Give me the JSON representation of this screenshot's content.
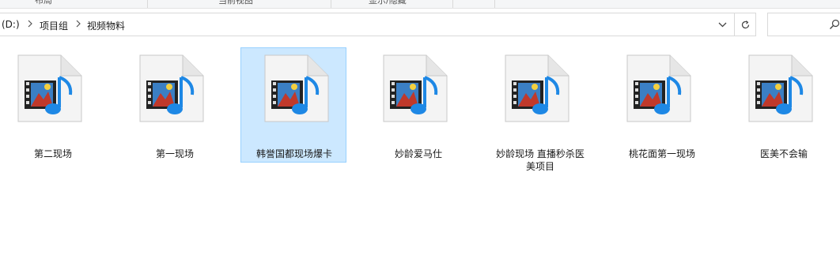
{
  "ribbon": {
    "labels": [
      "布局",
      "当前视图",
      "显示/隐藏"
    ]
  },
  "address": {
    "crumbs": [
      "(D:)",
      "项目组",
      "视频物料"
    ],
    "drive_prefix": "≤"
  },
  "search": {
    "placeholder": ""
  },
  "files": [
    {
      "label": "第二现场",
      "selected": false
    },
    {
      "label": "第一现场",
      "selected": false
    },
    {
      "label": "韩誉国都现场爆卡",
      "selected": true
    },
    {
      "label": "妙龄爱马仕",
      "selected": false
    },
    {
      "label": "妙龄现场 直播秒杀医美项目",
      "selected": false
    },
    {
      "label": "桃花面第一现场",
      "selected": false
    },
    {
      "label": "医美不会输",
      "selected": false
    }
  ],
  "icons": {
    "file": "video-audio-file-icon",
    "dropdown": "chevron-down-icon",
    "refresh": "refresh-icon",
    "search": "search-icon",
    "breadcrumb_separator": "chevron-right-icon"
  },
  "colors": {
    "selection_bg": "#cce8ff",
    "selection_border": "#99d1ff"
  }
}
